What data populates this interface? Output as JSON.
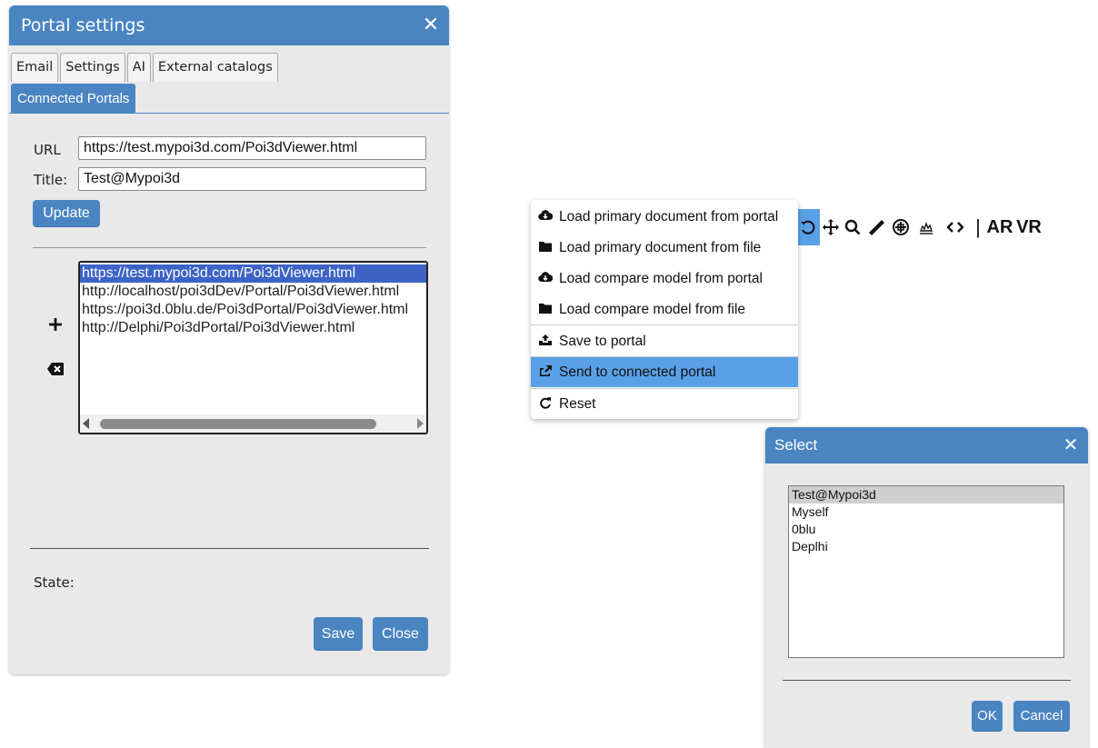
{
  "portal_dialog": {
    "title": "Portal settings",
    "close_glyph": "✕",
    "tabs": [
      "Email",
      "Settings",
      "AI",
      "External catalogs"
    ],
    "active_tab": "Connected Portals",
    "url_label": "URL",
    "url_value": "https://test.mypoi3d.com/Poi3dViewer.html",
    "title_label": "Title:",
    "title_value": "Test@Mypoi3d",
    "update_button": "Update",
    "portals": [
      "https://test.mypoi3d.com/Poi3dViewer.html",
      "http://localhost/poi3dDev/Portal/Poi3dViewer.html",
      "https://poi3d.0blu.de/Poi3dPortal/Poi3dViewer.html",
      "http://Delphi/Poi3dPortal/Poi3dViewer.html"
    ],
    "selected_index": 0,
    "add_icon": "plus-icon",
    "delete_icon": "backspace-icon",
    "state_label": "State:",
    "save_button": "Save",
    "close_button": "Close",
    "accent_color": "#4a85c2"
  },
  "context_menu": {
    "items": [
      {
        "icon": "cloud-download-icon",
        "label": "Load primary document from portal"
      },
      {
        "icon": "folder-icon",
        "label": "Load primary document from file"
      },
      {
        "icon": "cloud-download-icon",
        "label": "Load compare model from portal"
      },
      {
        "icon": "folder-icon",
        "label": "Load compare model from file"
      },
      {
        "icon": "upload-icon",
        "label": "Save to portal"
      },
      {
        "icon": "share-icon",
        "label": "Send to connected portal"
      },
      {
        "icon": "reset-icon",
        "label": "Reset"
      }
    ],
    "highlighted_index": 5,
    "highlight_color": "#5aa0e6"
  },
  "toolbar": {
    "icons": [
      "rotate-icon",
      "move-icon",
      "zoom-icon",
      "measure-icon",
      "explode-icon",
      "fire-icon",
      "code-icon"
    ],
    "separator": "|",
    "ar_label": "AR",
    "vr_label": "VR"
  },
  "select_dialog": {
    "title": "Select",
    "close_glyph": "✕",
    "items": [
      "Test@Mypoi3d",
      "Myself",
      "0blu",
      "Deplhi"
    ],
    "selected_index": 0,
    "ok_button": "OK",
    "cancel_button": "Cancel"
  }
}
